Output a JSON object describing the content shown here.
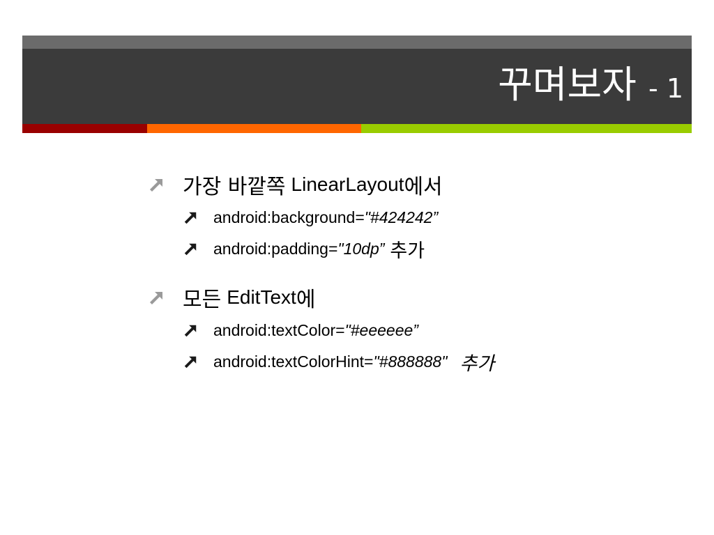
{
  "slide": {
    "title_main": "꾸며보자",
    "title_suffix": "- 1",
    "accent_colors": [
      "#990000",
      "#ff6600",
      "#99cc00"
    ],
    "header_color": "#3b3b3b",
    "header_top_color": "#6b6b6b"
  },
  "bullets": [
    {
      "kr_before": "가장 바깥쪽",
      "text": "LinearLayout",
      "kr_after": "에서",
      "sub": [
        {
          "attr": "android:background=",
          "value": "\"#424242”",
          "suffix": ""
        },
        {
          "attr": "android:padding=",
          "value": "\"10dp”",
          "suffix": "추가"
        }
      ]
    },
    {
      "kr_before": "모든",
      "text": "EditText",
      "kr_after": "에",
      "sub": [
        {
          "attr": "android:textColor=",
          "value": "\"#eeeeee”",
          "suffix": ""
        },
        {
          "attr": "android:textColorHint=",
          "value": "\"#888888\"",
          "suffix": "추가"
        }
      ]
    }
  ]
}
